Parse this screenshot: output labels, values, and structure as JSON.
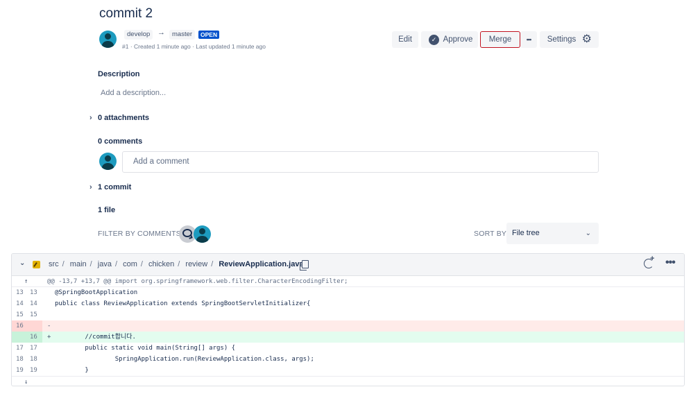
{
  "pull_request": {
    "title": "commit 2",
    "source_branch": "develop",
    "target_branch": "master",
    "arrow": "→",
    "status": "OPEN",
    "meta": "#1 · Created 1 minute ago · Last updated 1 minute ago"
  },
  "actions": {
    "edit": "Edit",
    "approve": "Approve",
    "merge": "Merge",
    "more": "•••",
    "settings": "Settings"
  },
  "description": {
    "heading": "Description",
    "placeholder": "Add a description..."
  },
  "attachments": {
    "label": "0 attachments"
  },
  "comments": {
    "heading": "0 comments",
    "input_placeholder": "Add a comment"
  },
  "commits": {
    "label": "1 commit"
  },
  "files": {
    "heading": "1 file",
    "filter_label": "FILTER BY COMMENTS",
    "sort_label": "SORT BY",
    "sort_value": "File tree"
  },
  "diff": {
    "path": [
      "src",
      "main",
      "java",
      "com",
      "chicken",
      "review"
    ],
    "filename": "ReviewApplication.java",
    "expand_up": "↑",
    "expand_down": "↓",
    "hunk_header": "@@ -13,7 +13,7 @@ import org.springframework.web.filter.CharacterEncodingFilter;",
    "lines": [
      {
        "old": "13",
        "new": "13",
        "sign": "",
        "code": "@SpringBootApplication",
        "type": "ctx"
      },
      {
        "old": "14",
        "new": "14",
        "sign": "",
        "code": "public class ReviewApplication extends SpringBootServletInitializer{",
        "type": "ctx"
      },
      {
        "old": "15",
        "new": "15",
        "sign": "",
        "code": "",
        "type": "ctx"
      },
      {
        "old": "16",
        "new": "",
        "sign": "-",
        "code": "",
        "type": "del"
      },
      {
        "old": "",
        "new": "16",
        "sign": "+",
        "code": "        //commit합니다.",
        "type": "add"
      },
      {
        "old": "17",
        "new": "17",
        "sign": "",
        "code": "        public static void main(String[] args) {",
        "type": "ctx"
      },
      {
        "old": "18",
        "new": "18",
        "sign": "",
        "code": "                SpringApplication.run(ReviewApplication.class, args);",
        "type": "ctx"
      },
      {
        "old": "19",
        "new": "19",
        "sign": "",
        "code": "        }",
        "type": "ctx"
      }
    ]
  },
  "colors": {
    "brand": "#0052cc",
    "merge_outline": "#c1121f",
    "added_bg": "#e3fcef",
    "removed_bg": "#ffebe9"
  }
}
